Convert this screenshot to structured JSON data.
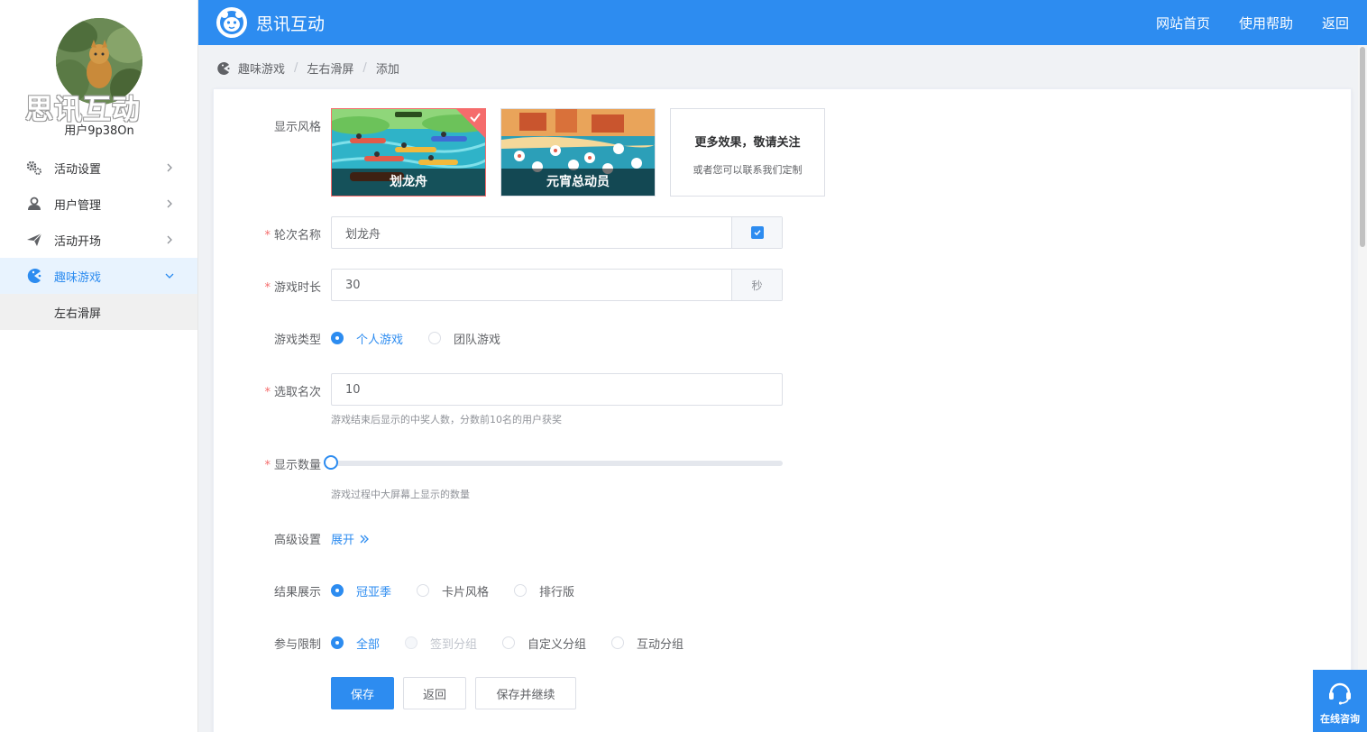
{
  "sidebar": {
    "brand_watermark": "思讯互动",
    "username": "用户9p38On",
    "menu": [
      {
        "label": "活动设置"
      },
      {
        "label": "用户管理"
      },
      {
        "label": "活动开场"
      },
      {
        "label": "趣味游戏"
      }
    ],
    "submenu": [
      {
        "label": "左右滑屏"
      }
    ]
  },
  "topbar": {
    "title": "思讯互动",
    "links": [
      "网站首页",
      "使用帮助",
      "返回"
    ]
  },
  "breadcrumb": [
    "趣味游戏",
    "左右滑屏",
    "添加"
  ],
  "form": {
    "style": {
      "label": "显示风格",
      "options": [
        {
          "caption": "划龙舟",
          "selected": true
        },
        {
          "caption": "元宵总动员",
          "selected": false
        }
      ],
      "more_title": "更多效果，敬请关注",
      "more_sub": "或者您可以联系我们定制"
    },
    "round_name": {
      "label": "轮次名称",
      "value": "划龙舟"
    },
    "duration": {
      "label": "游戏时长",
      "value": "30",
      "unit": "秒"
    },
    "game_type": {
      "label": "游戏类型",
      "options": [
        "个人游戏",
        "团队游戏"
      ]
    },
    "rank_count": {
      "label": "选取名次",
      "value": "10",
      "help": "游戏结束后显示的中奖人数，分数前10名的用户获奖"
    },
    "display_count": {
      "label": "显示数量",
      "help": "游戏过程中大屏幕上显示的数量",
      "level": 0
    },
    "advanced": {
      "label": "高级设置",
      "link": "展开"
    },
    "result_display": {
      "label": "结果展示",
      "options": [
        "冠亚季",
        "卡片风格",
        "排行版"
      ]
    },
    "participation": {
      "label": "参与限制",
      "options": [
        "全部",
        "签到分组",
        "自定义分组",
        "互动分组"
      ]
    },
    "buttons": {
      "save": "保存",
      "back": "返回",
      "save_continue": "保存并继续"
    }
  },
  "consult": {
    "label": "在线咨询"
  },
  "colors": {
    "primary": "#2d8cf0",
    "danger": "#f56c6c"
  }
}
